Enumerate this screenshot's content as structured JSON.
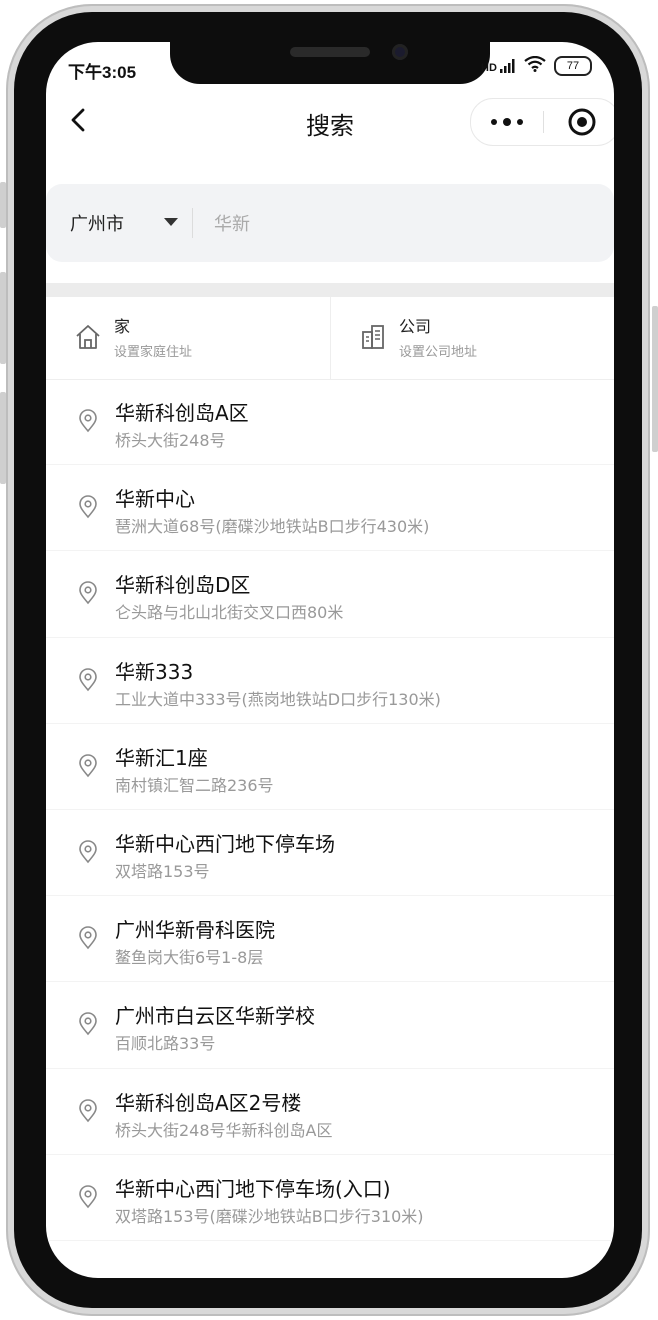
{
  "status": {
    "time": "下午3:05",
    "network": "HD",
    "battery": "77"
  },
  "nav": {
    "title": "搜索"
  },
  "search": {
    "city": "广州市",
    "placeholder": "华新",
    "value": ""
  },
  "shortcuts": {
    "home": {
      "title": "家",
      "subtitle": "设置家庭住址"
    },
    "company": {
      "title": "公司",
      "subtitle": "设置公司地址"
    }
  },
  "results": [
    {
      "name": "华新科创岛A区",
      "address": "桥头大街248号"
    },
    {
      "name": "华新中心",
      "address": "琶洲大道68号(磨碟沙地铁站B口步行430米)"
    },
    {
      "name": "华新科创岛D区",
      "address": "仑头路与北山北街交叉口西80米"
    },
    {
      "name": "华新333",
      "address": "工业大道中333号(燕岗地铁站D口步行130米)"
    },
    {
      "name": "华新汇1座",
      "address": "南村镇汇智二路236号"
    },
    {
      "name": "华新中心西门地下停车场",
      "address": "双塔路153号"
    },
    {
      "name": "广州华新骨科医院",
      "address": "鳌鱼岗大街6号1-8层"
    },
    {
      "name": "广州市白云区华新学校",
      "address": "百顺北路33号"
    },
    {
      "name": "华新科创岛A区2号楼",
      "address": "桥头大街248号华新科创岛A区"
    },
    {
      "name": "华新中心西门地下停车场(入口)",
      "address": "双塔路153号(磨碟沙地铁站B口步行310米)"
    }
  ],
  "colors": {
    "search_bg": "#f2f3f5",
    "secondary_text": "#999999",
    "divider": "#ececec"
  },
  "icons": [
    "back-arrow-icon",
    "more-dots-icon",
    "target-close-icon",
    "caret-down-icon",
    "home-icon",
    "building-icon",
    "location-pin-icon",
    "wifi-icon",
    "signal-icon",
    "battery-icon"
  ]
}
